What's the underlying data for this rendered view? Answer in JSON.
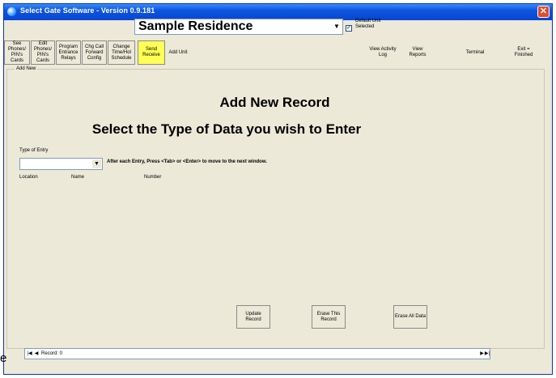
{
  "window": {
    "title": "Select Gate Software - Version 0.9.181",
    "close_symbol": "✕"
  },
  "toolbar": {
    "residence_name": "Sample Residence",
    "default_unit_label": "Default Unit Selected",
    "buttons": [
      {
        "label": "See Phones/ PIN's Cards"
      },
      {
        "label": "Edit Phones/ PIN's Cards"
      },
      {
        "label": "Program Entrance Relays"
      },
      {
        "label": "Chg Call Forward Config"
      },
      {
        "label": "Change Time/Hol Schedule"
      },
      {
        "label": "Send Receive"
      },
      {
        "label": "Add Unit"
      },
      {
        "label": "View Activity Log"
      },
      {
        "label": "View Reports"
      },
      {
        "label": "Terminal"
      },
      {
        "label": "Exit = Finished"
      }
    ]
  },
  "form": {
    "group_label": "Add New",
    "heading": "Add New Record",
    "subheading": "Select the Type of Data you wish to Enter",
    "type_label": "Type of Entry",
    "type_value": "",
    "hint": "After each Entry, Press <Tab> or <Enter> to move to the next window.",
    "columns": [
      "Location",
      "Name",
      "Number"
    ],
    "actions": [
      {
        "label": "Update Record"
      },
      {
        "label": "Erase This Record"
      },
      {
        "label": "Erase All Data"
      }
    ]
  },
  "navigator": {
    "first": "|◀",
    "prev": "◀",
    "record_text": "Record: 0",
    "next": "▶",
    "last": "▶|"
  },
  "stray_char": "e"
}
